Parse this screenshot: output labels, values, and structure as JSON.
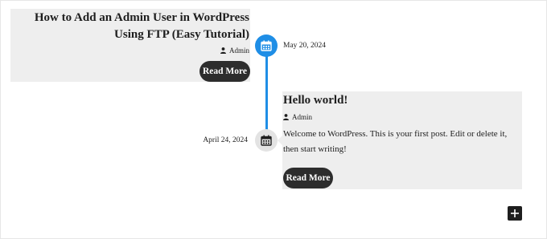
{
  "posts": [
    {
      "title": "How to Add an Admin User in WordPress Using FTP (Easy Tutorial)",
      "author": "Admin",
      "date": "May 20, 2024",
      "read_more": "Read More"
    },
    {
      "title": "Hello world!",
      "author": "Admin",
      "date": "April 24, 2024",
      "excerpt": "Welcome to WordPress. This is your first post. Edit or delete it, then start writing!",
      "read_more": "Read More"
    }
  ],
  "icons": {
    "timeline_marker": "calendar-icon",
    "author": "user-icon",
    "add": "plus-icon"
  },
  "colors": {
    "accent": "#1f8ee6",
    "card_bg": "#eeeeee",
    "button_bg": "#2d2d2d",
    "inactive_marker": "#e3e3e3"
  }
}
